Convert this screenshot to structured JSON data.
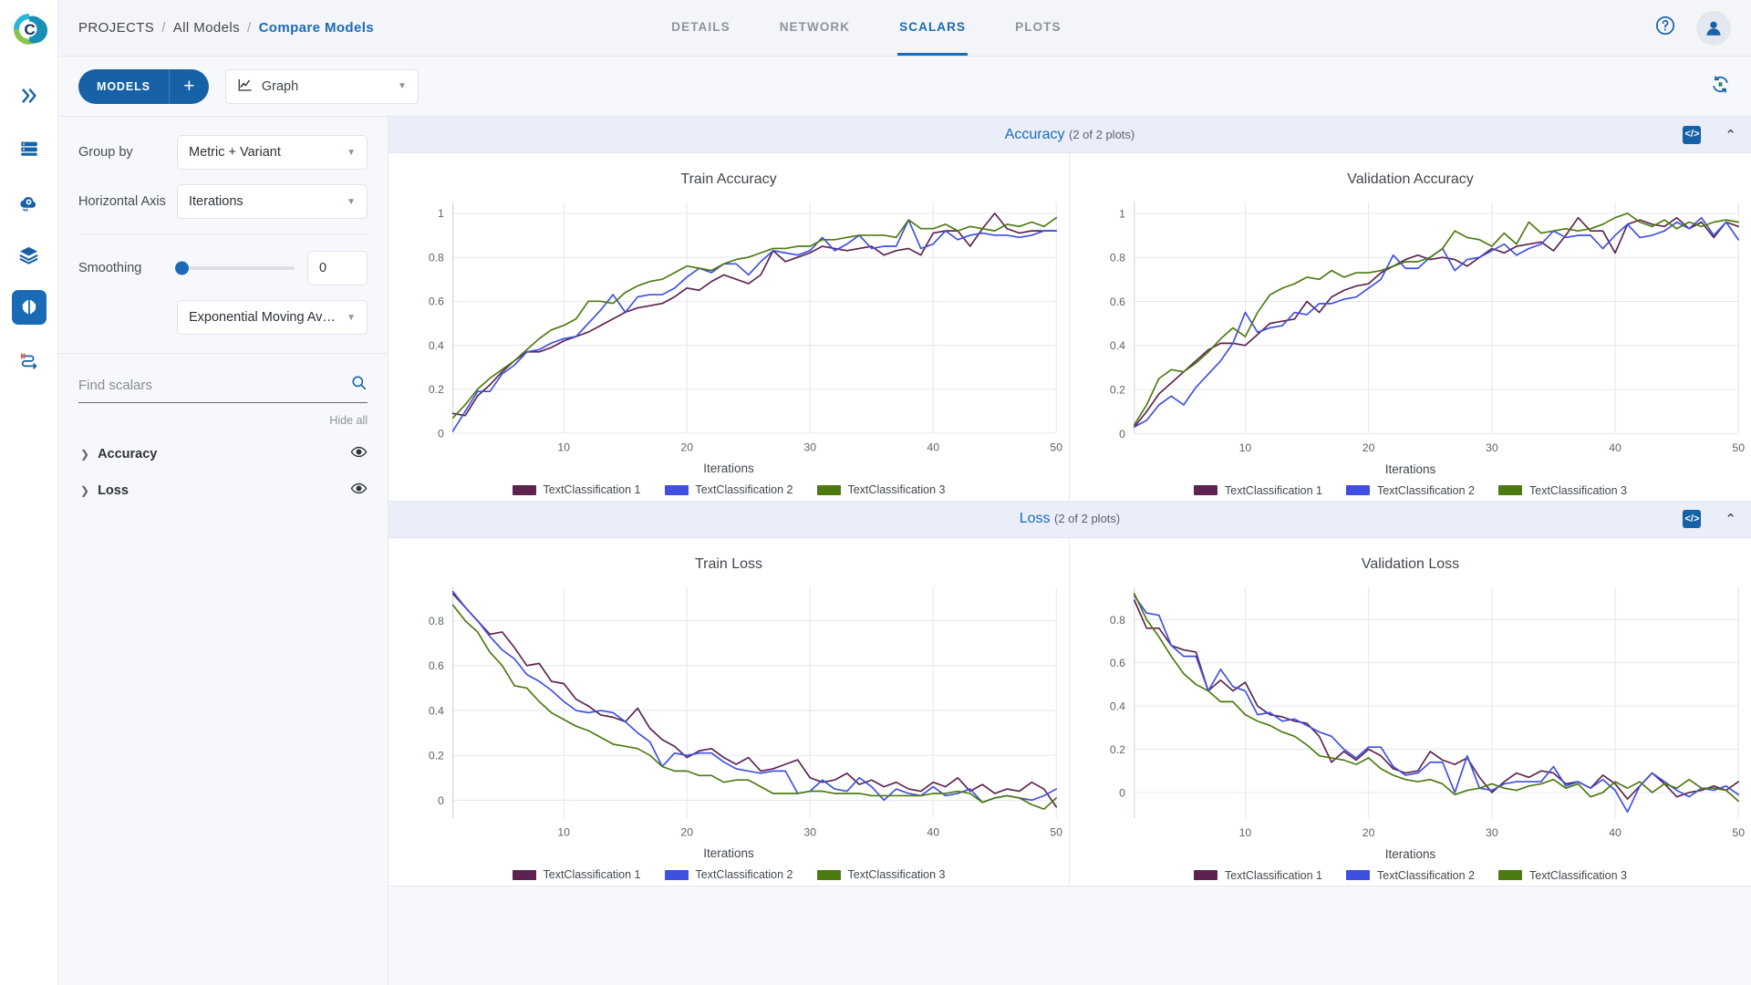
{
  "brand": {
    "accent": "#1a6bb5",
    "logo_name": "clearml-logo"
  },
  "rail": {
    "items": [
      {
        "name": "pipelines",
        "icon": "double-chevron-icon",
        "active": false
      },
      {
        "name": "datasets",
        "icon": "server-icon",
        "active": false
      },
      {
        "name": "orchestration",
        "icon": "cloud-gear-icon",
        "active": false
      },
      {
        "name": "reports",
        "icon": "layers-icon",
        "active": false
      },
      {
        "name": "models",
        "icon": "brain-icon",
        "active": true
      },
      {
        "name": "workflows",
        "icon": "workflow-icon",
        "active": false
      }
    ]
  },
  "header": {
    "breadcrumb": [
      {
        "label": "PROJECTS",
        "current": false
      },
      {
        "label": "/",
        "current": false
      },
      {
        "label": "All Models",
        "current": false
      },
      {
        "label": "/",
        "current": false
      },
      {
        "label": "Compare Models",
        "current": true
      }
    ],
    "tabs": [
      {
        "label": "DETAILS",
        "active": false
      },
      {
        "label": "NETWORK",
        "active": false
      },
      {
        "label": "SCALARS",
        "active": true
      },
      {
        "label": "PLOTS",
        "active": false
      }
    ],
    "help_icon": "question-circle-icon",
    "avatar_icon": "user-avatar-icon"
  },
  "toolbar": {
    "models_label": "MODELS",
    "add_label": "+",
    "view_select": {
      "value": "Graph",
      "icon": "line-chart-icon"
    },
    "refresh_icon": "auto-refresh-icon"
  },
  "settings": {
    "group_by": {
      "label": "Group by",
      "value": "Metric + Variant"
    },
    "horizontal_axis": {
      "label": "Horizontal Axis",
      "value": "Iterations"
    },
    "smoothing": {
      "label": "Smoothing",
      "value": "0",
      "slider_percent": 0,
      "algorithm": "Exponential Moving Av…"
    },
    "search": {
      "placeholder": "Find scalars",
      "value": "",
      "icon": "search-icon"
    },
    "hide_all_label": "Hide all",
    "tree": [
      {
        "label": "Accuracy",
        "expanded": false,
        "visible": true
      },
      {
        "label": "Loss",
        "expanded": false,
        "visible": true
      }
    ]
  },
  "series_colors": {
    "TextClassification 1": "#5c2350",
    "TextClassification 2": "#3f4fe0",
    "TextClassification 3": "#4d7a10"
  },
  "groups": [
    {
      "title": "Accuracy",
      "count_label": "(2 of 2 plots)",
      "code_icon": "code-brackets-icon",
      "collapse_icon": "chevron-up-icon",
      "plot_ids": [
        0,
        1
      ]
    },
    {
      "title": "Loss",
      "count_label": "(2 of 2 plots)",
      "code_icon": "code-brackets-icon",
      "collapse_icon": "chevron-up-icon",
      "plot_ids": [
        2,
        3
      ]
    }
  ],
  "chart_data": [
    {
      "type": "line",
      "title": "Train Accuracy",
      "xlabel": "Iterations",
      "ylabel": "",
      "xlim": [
        1,
        50
      ],
      "ylim": [
        0,
        1.05
      ],
      "xticks": [
        10,
        20,
        30,
        40,
        50
      ],
      "yticks": [
        0,
        0.2,
        0.4,
        0.6,
        0.8,
        1
      ],
      "ytick_labels": [
        "0",
        "0.2",
        "0.4",
        "0.6",
        "0.8",
        "1"
      ],
      "grid": true,
      "legend": [
        "TextClassification 1",
        "TextClassification 2",
        "TextClassification 3"
      ],
      "series": [
        {
          "name": "TextClassification 1",
          "color": "#5c2350",
          "values": [
            0.09,
            0.08,
            0.17,
            0.22,
            0.28,
            0.33,
            0.37,
            0.37,
            0.39,
            0.42,
            0.44,
            0.46,
            0.49,
            0.52,
            0.55,
            0.57,
            0.58,
            0.59,
            0.62,
            0.66,
            0.65,
            0.69,
            0.72,
            0.7,
            0.68,
            0.72,
            0.83,
            0.78,
            0.8,
            0.82,
            0.85,
            0.84,
            0.83,
            0.84,
            0.85,
            0.81,
            0.83,
            0.84,
            0.81,
            0.91,
            0.92,
            0.92,
            0.85,
            0.93,
            1.0,
            0.93,
            0.91,
            0.92,
            0.92,
            0.92
          ]
        },
        {
          "name": "TextClassification 2",
          "color": "#3f4fe0",
          "values": [
            0.01,
            0.1,
            0.19,
            0.19,
            0.27,
            0.31,
            0.37,
            0.38,
            0.41,
            0.43,
            0.44,
            0.5,
            0.56,
            0.63,
            0.55,
            0.62,
            0.63,
            0.63,
            0.66,
            0.71,
            0.75,
            0.73,
            0.77,
            0.77,
            0.72,
            0.78,
            0.83,
            0.82,
            0.81,
            0.83,
            0.89,
            0.83,
            0.86,
            0.9,
            0.84,
            0.85,
            0.85,
            0.97,
            0.84,
            0.86,
            0.92,
            0.88,
            0.9,
            0.91,
            0.9,
            0.9,
            0.89,
            0.9,
            0.92,
            0.92
          ]
        },
        {
          "name": "TextClassification 3",
          "color": "#4d7a10",
          "values": [
            0.07,
            0.13,
            0.2,
            0.25,
            0.29,
            0.33,
            0.38,
            0.43,
            0.47,
            0.49,
            0.52,
            0.6,
            0.6,
            0.59,
            0.64,
            0.67,
            0.69,
            0.7,
            0.73,
            0.76,
            0.75,
            0.74,
            0.77,
            0.79,
            0.8,
            0.82,
            0.84,
            0.84,
            0.85,
            0.85,
            0.88,
            0.88,
            0.89,
            0.9,
            0.9,
            0.9,
            0.89,
            0.97,
            0.93,
            0.93,
            0.95,
            0.92,
            0.94,
            0.93,
            0.92,
            0.95,
            0.94,
            0.96,
            0.94,
            0.98
          ]
        }
      ]
    },
    {
      "type": "line",
      "title": "Validation Accuracy",
      "xlabel": "Iterations",
      "ylabel": "",
      "xlim": [
        1,
        50
      ],
      "ylim": [
        0,
        1.05
      ],
      "xticks": [
        10,
        20,
        30,
        40,
        50
      ],
      "yticks": [
        0,
        0.2,
        0.4,
        0.6,
        0.8,
        1
      ],
      "ytick_labels": [
        "0",
        "0.2",
        "0.4",
        "0.6",
        "0.8",
        "1"
      ],
      "grid": true,
      "legend": [
        "TextClassification 1",
        "TextClassification 2",
        "TextClassification 3"
      ],
      "series": [
        {
          "name": "TextClassification 1",
          "color": "#5c2350",
          "values": [
            0.03,
            0.1,
            0.18,
            0.23,
            0.28,
            0.33,
            0.38,
            0.41,
            0.41,
            0.4,
            0.45,
            0.5,
            0.51,
            0.52,
            0.6,
            0.55,
            0.62,
            0.65,
            0.67,
            0.68,
            0.73,
            0.76,
            0.79,
            0.81,
            0.79,
            0.8,
            0.79,
            0.76,
            0.8,
            0.84,
            0.82,
            0.85,
            0.86,
            0.87,
            0.83,
            0.9,
            0.98,
            0.92,
            0.92,
            0.82,
            0.95,
            0.97,
            0.95,
            0.94,
            0.98,
            0.93,
            0.96,
            0.89,
            0.96,
            0.94
          ]
        },
        {
          "name": "TextClassification 2",
          "color": "#3f4fe0",
          "values": [
            0.03,
            0.06,
            0.13,
            0.17,
            0.13,
            0.21,
            0.27,
            0.33,
            0.41,
            0.55,
            0.46,
            0.48,
            0.49,
            0.55,
            0.54,
            0.59,
            0.59,
            0.61,
            0.62,
            0.66,
            0.7,
            0.81,
            0.75,
            0.75,
            0.8,
            0.84,
            0.74,
            0.79,
            0.8,
            0.83,
            0.86,
            0.81,
            0.84,
            0.86,
            0.92,
            0.89,
            0.9,
            0.9,
            0.84,
            0.9,
            0.95,
            0.89,
            0.9,
            0.92,
            0.96,
            0.93,
            0.98,
            0.9,
            0.96,
            0.88
          ]
        },
        {
          "name": "TextClassification 3",
          "color": "#4d7a10",
          "values": [
            0.04,
            0.13,
            0.25,
            0.29,
            0.28,
            0.32,
            0.37,
            0.43,
            0.48,
            0.44,
            0.55,
            0.63,
            0.66,
            0.68,
            0.71,
            0.7,
            0.74,
            0.71,
            0.73,
            0.73,
            0.74,
            0.76,
            0.78,
            0.78,
            0.8,
            0.84,
            0.92,
            0.89,
            0.88,
            0.85,
            0.91,
            0.86,
            0.96,
            0.91,
            0.92,
            0.93,
            0.92,
            0.93,
            0.95,
            0.98,
            1.0,
            0.96,
            0.94,
            0.97,
            0.93,
            0.96,
            0.94,
            0.96,
            0.97,
            0.96
          ]
        }
      ]
    },
    {
      "type": "line",
      "title": "Train Loss",
      "xlabel": "Iterations",
      "ylabel": "",
      "xlim": [
        1,
        50
      ],
      "ylim": [
        -0.08,
        0.95
      ],
      "xticks": [
        10,
        20,
        30,
        40,
        50
      ],
      "yticks": [
        0,
        0.2,
        0.4,
        0.6,
        0.8
      ],
      "ytick_labels": [
        "0",
        "0.2",
        "0.4",
        "0.6",
        "0.8"
      ],
      "grid": true,
      "legend": [
        "TextClassification 1",
        "TextClassification 2",
        "TextClassification 3"
      ],
      "series": [
        {
          "name": "TextClassification 1",
          "color": "#5c2350",
          "values": [
            0.92,
            0.86,
            0.8,
            0.74,
            0.75,
            0.68,
            0.6,
            0.61,
            0.53,
            0.52,
            0.45,
            0.42,
            0.38,
            0.37,
            0.35,
            0.41,
            0.32,
            0.27,
            0.24,
            0.19,
            0.22,
            0.23,
            0.19,
            0.16,
            0.19,
            0.13,
            0.14,
            0.16,
            0.18,
            0.1,
            0.08,
            0.09,
            0.12,
            0.07,
            0.09,
            0.06,
            0.08,
            0.05,
            0.04,
            0.08,
            0.06,
            0.1,
            0.04,
            0.07,
            0.03,
            0.05,
            0.04,
            0.08,
            0.05,
            -0.03
          ]
        },
        {
          "name": "TextClassification 2",
          "color": "#3f4fe0",
          "values": [
            0.93,
            0.86,
            0.8,
            0.73,
            0.67,
            0.63,
            0.56,
            0.53,
            0.49,
            0.44,
            0.4,
            0.39,
            0.4,
            0.39,
            0.35,
            0.3,
            0.26,
            0.15,
            0.21,
            0.2,
            0.21,
            0.21,
            0.17,
            0.14,
            0.13,
            0.12,
            0.13,
            0.13,
            0.03,
            0.04,
            0.09,
            0.05,
            0.04,
            0.1,
            0.06,
            0.0,
            0.05,
            0.03,
            0.02,
            0.06,
            0.02,
            0.03,
            0.05,
            -0.01,
            0.01,
            0.02,
            0.01,
            0.0,
            0.02,
            0.05
          ]
        },
        {
          "name": "TextClassification 3",
          "color": "#4d7a10",
          "values": [
            0.87,
            0.8,
            0.75,
            0.66,
            0.6,
            0.51,
            0.5,
            0.44,
            0.39,
            0.36,
            0.33,
            0.31,
            0.28,
            0.25,
            0.24,
            0.23,
            0.2,
            0.15,
            0.13,
            0.13,
            0.11,
            0.11,
            0.08,
            0.09,
            0.09,
            0.06,
            0.03,
            0.03,
            0.03,
            0.04,
            0.04,
            0.03,
            0.03,
            0.03,
            0.02,
            0.02,
            0.02,
            0.02,
            0.02,
            0.03,
            0.03,
            0.04,
            0.03,
            -0.01,
            0.01,
            0.02,
            0.01,
            -0.02,
            -0.04,
            0.01
          ]
        }
      ]
    },
    {
      "type": "line",
      "title": "Validation Loss",
      "xlabel": "Iterations",
      "ylabel": "",
      "xlim": [
        1,
        50
      ],
      "ylim": [
        -0.12,
        0.95
      ],
      "xticks": [
        10,
        20,
        30,
        40,
        50
      ],
      "yticks": [
        0,
        0.2,
        0.4,
        0.6,
        0.8
      ],
      "ytick_labels": [
        "0",
        "0.2",
        "0.4",
        "0.6",
        "0.8"
      ],
      "grid": true,
      "legend": [
        "TextClassification 1",
        "TextClassification 2",
        "TextClassification 3"
      ],
      "series": [
        {
          "name": "TextClassification 1",
          "color": "#5c2350",
          "values": [
            0.89,
            0.76,
            0.76,
            0.68,
            0.66,
            0.65,
            0.47,
            0.52,
            0.47,
            0.51,
            0.4,
            0.36,
            0.35,
            0.33,
            0.32,
            0.26,
            0.14,
            0.19,
            0.15,
            0.2,
            0.17,
            0.11,
            0.09,
            0.1,
            0.19,
            0.15,
            0.13,
            0.16,
            0.07,
            0.0,
            0.05,
            0.09,
            0.07,
            0.1,
            0.09,
            0.04,
            0.05,
            0.02,
            0.08,
            0.04,
            -0.03,
            0.03,
            0.09,
            0.04,
            -0.02,
            0.0,
            0.01,
            0.03,
            0.01,
            0.05
          ]
        },
        {
          "name": "TextClassification 2",
          "color": "#3f4fe0",
          "values": [
            0.91,
            0.83,
            0.82,
            0.68,
            0.63,
            0.63,
            0.47,
            0.57,
            0.49,
            0.47,
            0.36,
            0.37,
            0.33,
            0.34,
            0.31,
            0.28,
            0.26,
            0.2,
            0.16,
            0.21,
            0.21,
            0.12,
            0.08,
            0.09,
            0.14,
            0.14,
            0.0,
            0.17,
            0.02,
            0.01,
            0.04,
            0.05,
            0.05,
            0.05,
            0.12,
            0.03,
            0.05,
            0.02,
            0.06,
            0.01,
            -0.09,
            0.03,
            0.09,
            0.05,
            0.01,
            -0.02,
            0.02,
            0.01,
            0.03,
            -0.01
          ]
        },
        {
          "name": "TextClassification 3",
          "color": "#4d7a10",
          "values": [
            0.92,
            0.8,
            0.72,
            0.63,
            0.55,
            0.5,
            0.47,
            0.42,
            0.42,
            0.36,
            0.33,
            0.31,
            0.28,
            0.26,
            0.22,
            0.17,
            0.16,
            0.15,
            0.13,
            0.16,
            0.11,
            0.08,
            0.06,
            0.05,
            0.06,
            0.04,
            -0.01,
            0.01,
            0.02,
            0.04,
            0.02,
            0.01,
            0.03,
            0.04,
            0.06,
            0.02,
            0.04,
            -0.02,
            0.0,
            0.05,
            0.02,
            0.05,
            0.0,
            0.04,
            0.02,
            0.06,
            0.02,
            0.02,
            0.01,
            -0.04
          ]
        }
      ]
    }
  ]
}
